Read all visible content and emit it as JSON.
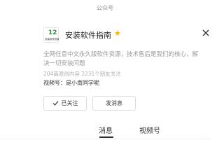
{
  "header": {
    "label": "公众号"
  },
  "account": {
    "logo_mark": "12",
    "logo_text": "安装软件指南",
    "name": "安装软件指南",
    "description_lines": [
      "全网任意中文永久版软件资源，技术售后是我们的核心，解",
      "决一切安装问题"
    ],
    "stats": "204篇原创内容  2231个朋友关注",
    "video_channel": "视频号：是小南同学呢"
  },
  "actions": {
    "follow_label": "已关注",
    "message_label": "发消息"
  },
  "tabs": [
    {
      "label": "消息"
    },
    {
      "label": "视频号"
    }
  ],
  "colors": {
    "star": "#f5b800",
    "logo_green": "#2f8f3f",
    "muted_text": "#9a9a9a"
  }
}
